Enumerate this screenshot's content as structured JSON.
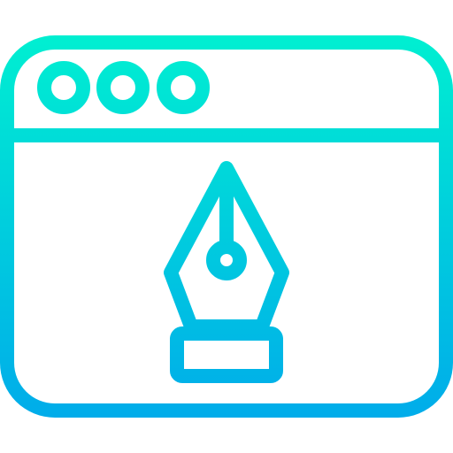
{
  "icon": {
    "name": "browser-window-pen-tool-icon",
    "gradient_top": "#00EFD1",
    "gradient_bottom": "#00ACEA"
  }
}
